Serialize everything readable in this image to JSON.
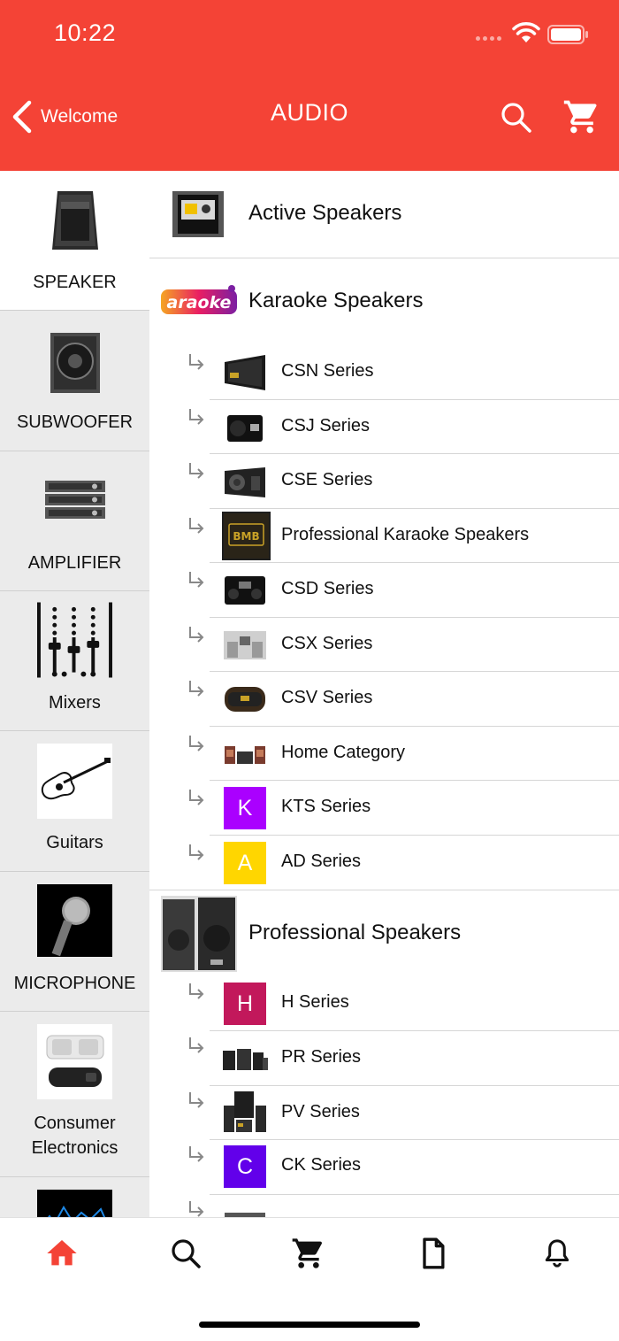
{
  "status_bar": {
    "time": "10:22"
  },
  "header": {
    "back_label": "Welcome",
    "title": "AUDIO",
    "background": "#f44336"
  },
  "sidebar": {
    "items": [
      {
        "label": "SPEAKER",
        "icon": "speaker-image",
        "active": true
      },
      {
        "label": "SUBWOOFER",
        "icon": "subwoofer-image",
        "active": false
      },
      {
        "label": "AMPLIFIER",
        "icon": "amplifier-image",
        "active": false
      },
      {
        "label": "Mixers",
        "icon": "mixer-image",
        "active": false
      },
      {
        "label": "Guitars",
        "icon": "guitar-image",
        "active": false
      },
      {
        "label": "MICROPHONE",
        "icon": "microphone-image",
        "active": false
      },
      {
        "label": "Consumer Electronics",
        "icon": "consumer-electronics-image",
        "active": false
      }
    ]
  },
  "categories": [
    {
      "label": "Active Speakers"
    },
    {
      "label": "Karaoke Speakers",
      "logo_text": "araoke",
      "children": [
        {
          "label": "CSN Series"
        },
        {
          "label": "CSJ Series"
        },
        {
          "label": "CSE Series"
        },
        {
          "label": "Professional Karaoke Speakers",
          "badge": "BMB"
        },
        {
          "label": "CSD Series"
        },
        {
          "label": "CSX Series"
        },
        {
          "label": "CSV Series"
        },
        {
          "label": "Home Category"
        },
        {
          "label": "KTS Series",
          "letter": "K",
          "color": "#aa00ff"
        },
        {
          "label": "AD Series",
          "letter": "A",
          "color": "#ffd600"
        }
      ]
    },
    {
      "label": "Professional Speakers",
      "children": [
        {
          "label": "H Series",
          "letter": "H",
          "color": "#c2185b"
        },
        {
          "label": "PR Series"
        },
        {
          "label": "PV Series"
        },
        {
          "label": "CK Series",
          "letter": "C",
          "color": "#6200ea"
        }
      ]
    }
  ],
  "tabbar": {
    "items": [
      "home-icon",
      "search-icon",
      "cart-icon",
      "document-icon",
      "bell-icon"
    ],
    "active_color": "#f44336"
  }
}
